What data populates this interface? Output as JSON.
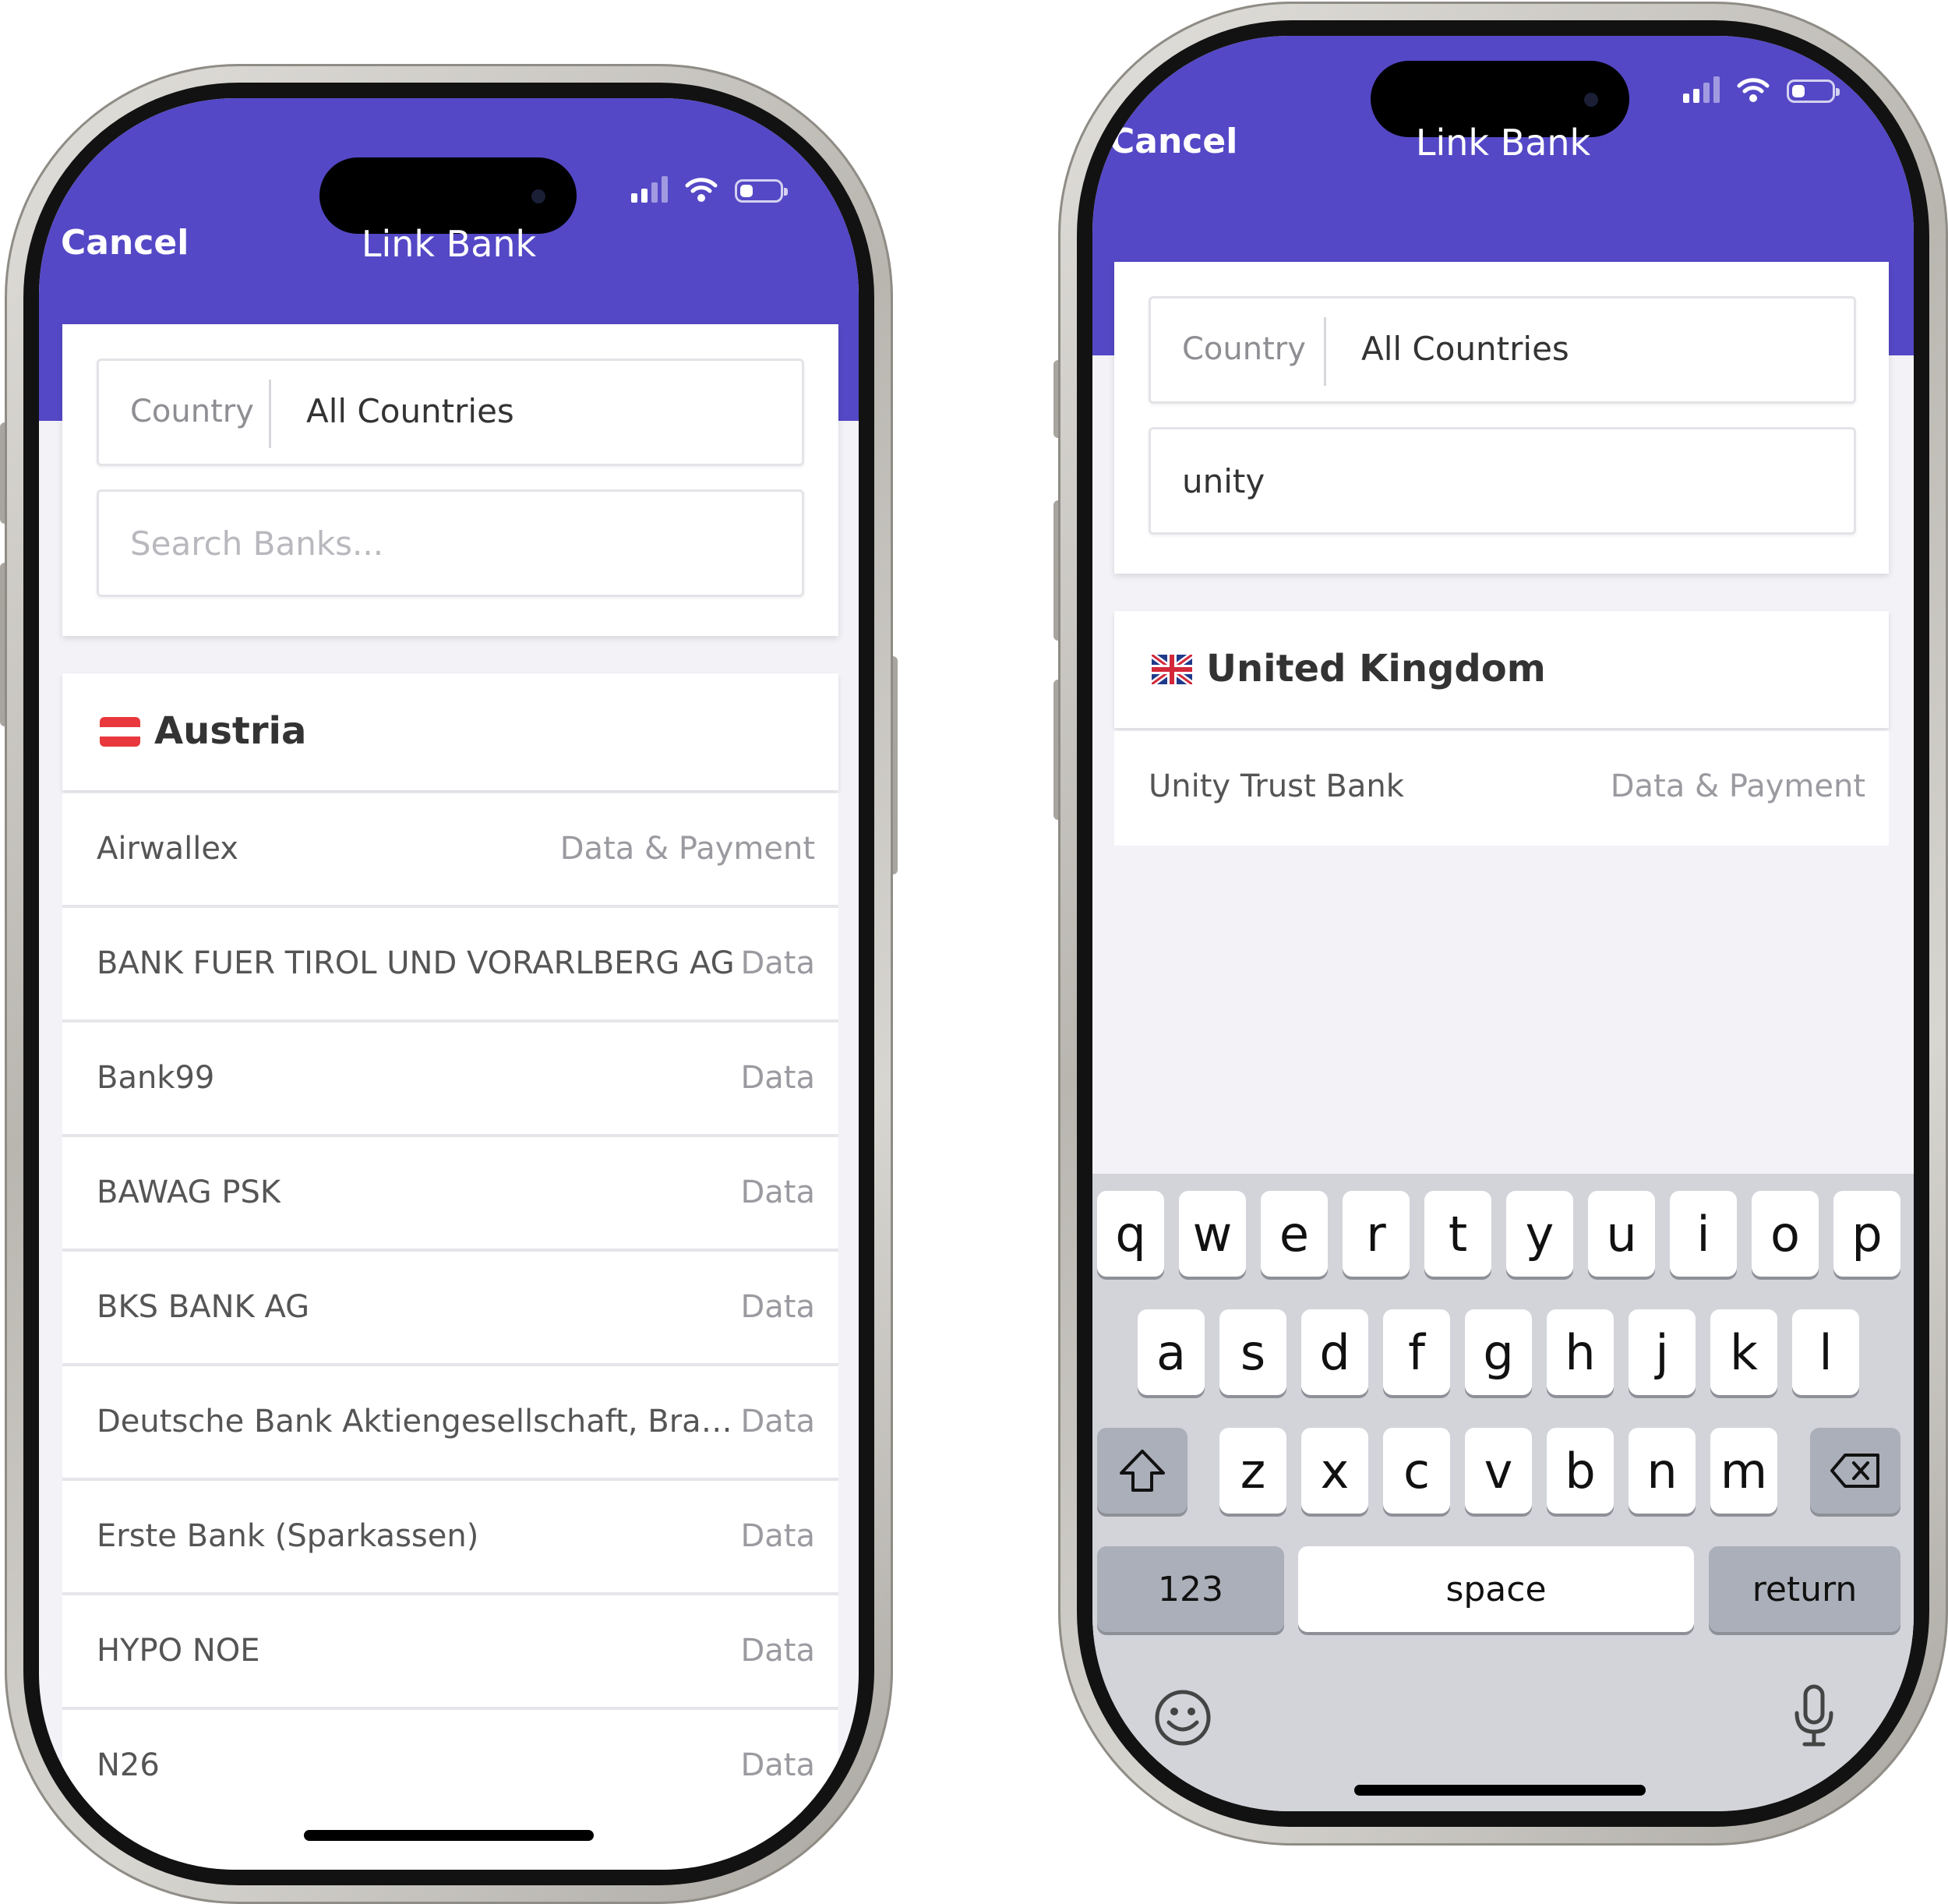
{
  "left_phone": {
    "nav": {
      "cancel": "Cancel",
      "title": "Link Bank"
    },
    "country_label": "Country",
    "country_value": "All Countries",
    "search_placeholder": "Search Banks...",
    "section": {
      "flag": "austria-flag-icon",
      "title": "Austria"
    },
    "banks": [
      {
        "name": "Airwallex",
        "type": "Data & Payment"
      },
      {
        "name": "BANK FUER TIROL UND VORARLBERG AG",
        "type": "Data"
      },
      {
        "name": "Bank99",
        "type": "Data"
      },
      {
        "name": "BAWAG PSK",
        "type": "Data"
      },
      {
        "name": "BKS BANK AG",
        "type": "Data"
      },
      {
        "name": "Deutsche Bank Aktiengesellschaft, Branc…",
        "type": "Data"
      },
      {
        "name": "Erste Bank (Sparkassen)",
        "type": "Data"
      },
      {
        "name": "HYPO NOE",
        "type": "Data"
      },
      {
        "name": "N26",
        "type": "Data"
      }
    ]
  },
  "right_phone": {
    "nav": {
      "cancel": "Cancel",
      "title": "Link Bank"
    },
    "country_label": "Country",
    "country_value": "All Countries",
    "search_value": "unity",
    "section": {
      "flag": "uk-flag-icon",
      "title": "United Kingdom"
    },
    "banks": [
      {
        "name": "Unity Trust Bank",
        "type": "Data & Payment"
      }
    ],
    "keyboard": {
      "row1": [
        "q",
        "w",
        "e",
        "r",
        "t",
        "y",
        "u",
        "i",
        "o",
        "p"
      ],
      "row2": [
        "a",
        "s",
        "d",
        "f",
        "g",
        "h",
        "j",
        "k",
        "l"
      ],
      "row3": [
        "z",
        "x",
        "c",
        "v",
        "b",
        "n",
        "m"
      ],
      "shift_icon": "shift-icon",
      "delete_icon": "delete-icon",
      "numbers": "123",
      "space": "space",
      "return": "return",
      "emoji_icon": "emoji-icon",
      "mic_icon": "microphone-icon"
    }
  },
  "colors": {
    "header": "#5448c6",
    "background": "#f2f2f7"
  }
}
